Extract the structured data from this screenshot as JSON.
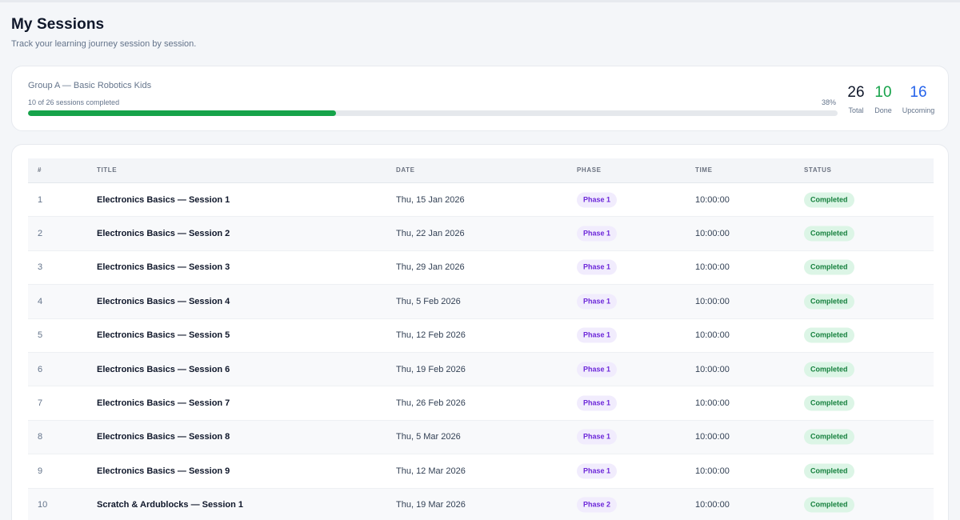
{
  "page": {
    "title": "My Sessions",
    "subtitle": "Track your learning journey session by session."
  },
  "summary": {
    "group_name": "Group A — Basic Robotics Kids",
    "progress_text": "10 of 26 sessions completed",
    "progress_percent_label": "38%",
    "progress_fraction": 0.38,
    "stats": {
      "total": {
        "value": "26",
        "label": "Total"
      },
      "done": {
        "value": "10",
        "label": "Done"
      },
      "upcoming": {
        "value": "16",
        "label": "Upcoming"
      }
    },
    "colors": {
      "done": "#16a34a",
      "upcoming": "#2563eb",
      "progress_fill": "#16a34a"
    }
  },
  "table": {
    "headers": {
      "num": "#",
      "title": "TITLE",
      "date": "DATE",
      "phase": "PHASE",
      "time": "TIME",
      "status": "STATUS"
    },
    "rows": [
      {
        "num": "1",
        "title": "Electronics Basics — Session 1",
        "date": "Thu, 15 Jan 2026",
        "phase": "Phase 1",
        "time": "10:00:00",
        "status": "Completed"
      },
      {
        "num": "2",
        "title": "Electronics Basics — Session 2",
        "date": "Thu, 22 Jan 2026",
        "phase": "Phase 1",
        "time": "10:00:00",
        "status": "Completed"
      },
      {
        "num": "3",
        "title": "Electronics Basics — Session 3",
        "date": "Thu, 29 Jan 2026",
        "phase": "Phase 1",
        "time": "10:00:00",
        "status": "Completed"
      },
      {
        "num": "4",
        "title": "Electronics Basics — Session 4",
        "date": "Thu, 5 Feb 2026",
        "phase": "Phase 1",
        "time": "10:00:00",
        "status": "Completed"
      },
      {
        "num": "5",
        "title": "Electronics Basics — Session 5",
        "date": "Thu, 12 Feb 2026",
        "phase": "Phase 1",
        "time": "10:00:00",
        "status": "Completed"
      },
      {
        "num": "6",
        "title": "Electronics Basics — Session 6",
        "date": "Thu, 19 Feb 2026",
        "phase": "Phase 1",
        "time": "10:00:00",
        "status": "Completed"
      },
      {
        "num": "7",
        "title": "Electronics Basics — Session 7",
        "date": "Thu, 26 Feb 2026",
        "phase": "Phase 1",
        "time": "10:00:00",
        "status": "Completed"
      },
      {
        "num": "8",
        "title": "Electronics Basics — Session 8",
        "date": "Thu, 5 Mar 2026",
        "phase": "Phase 1",
        "time": "10:00:00",
        "status": "Completed"
      },
      {
        "num": "9",
        "title": "Electronics Basics — Session 9",
        "date": "Thu, 12 Mar 2026",
        "phase": "Phase 1",
        "time": "10:00:00",
        "status": "Completed"
      },
      {
        "num": "10",
        "title": "Scratch & Ardublocks — Session 1",
        "date": "Thu, 19 Mar 2026",
        "phase": "Phase 2",
        "time": "10:00:00",
        "status": "Completed"
      }
    ]
  }
}
